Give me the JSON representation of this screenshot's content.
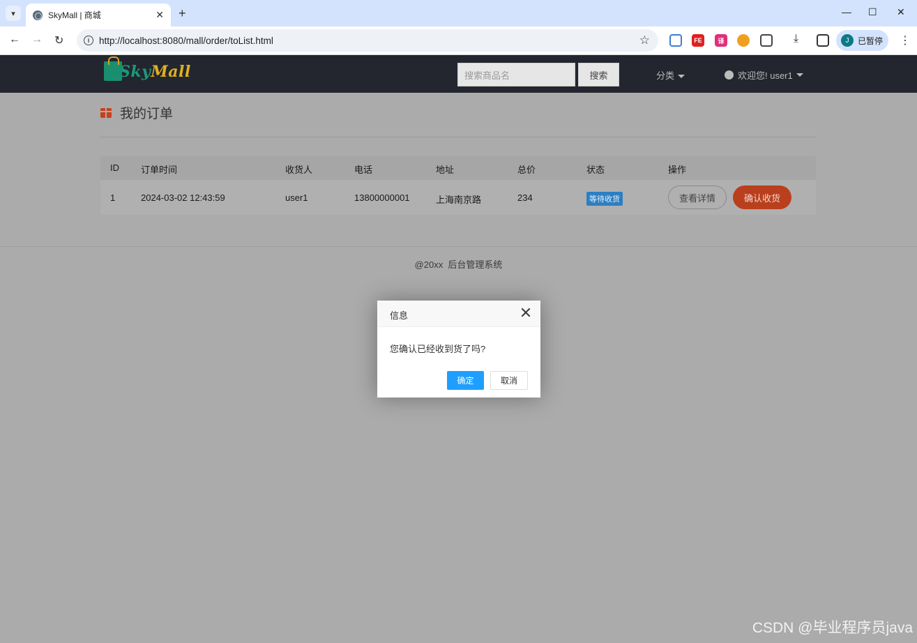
{
  "browser": {
    "tab_title": "SkyMall | 商城",
    "url": "http://localhost:8080/mall/order/toList.html",
    "profile_initial": "J",
    "profile_label": "已暂停",
    "new_tab": "+",
    "minimize": "—",
    "maximize": "☐",
    "close": "✕"
  },
  "header": {
    "logo_sky": "Sky",
    "logo_mall": "Mall",
    "search_placeholder": "搜索商品名",
    "search_button": "搜索",
    "category_menu": "分类",
    "user_menu": "欢迎您! user1"
  },
  "page": {
    "title": "我的订单",
    "columns": [
      "ID",
      "订单时间",
      "收货人",
      "电话",
      "地址",
      "总价",
      "状态",
      "操作"
    ],
    "orders": [
      {
        "id": "1",
        "time": "2024-03-02 12:43:59",
        "receiver": "user1",
        "phone": "13800000001",
        "address": "上海南京路",
        "total": "234",
        "status": "等待收货",
        "detail_button": "查看详情",
        "confirm_button": "确认收货"
      }
    ]
  },
  "footer": {
    "text": "@20xx  后台管理系统"
  },
  "dialog": {
    "title": "信息",
    "message": "您确认已经收到货了吗?",
    "ok": "确定",
    "cancel": "取消"
  },
  "watermark": "CSDN @毕业程序员java"
}
